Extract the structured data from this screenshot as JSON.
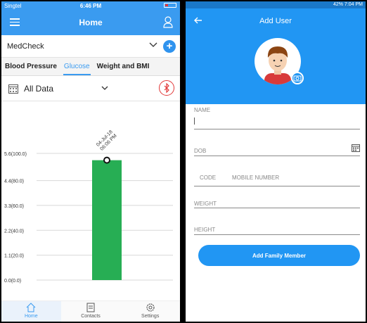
{
  "left": {
    "status": {
      "carrier": "Singtel",
      "time": "6:46 PM"
    },
    "nav": {
      "title": "Home"
    },
    "medcheck": {
      "name": "MedCheck"
    },
    "tabs": [
      "Blood Pressure",
      "Glucose",
      "Weight and BMI"
    ],
    "active_tab": "Glucose",
    "filter": {
      "label": "All Data"
    },
    "bottom_nav": [
      {
        "label": "Home",
        "icon": "home-icon"
      },
      {
        "label": "Contacts",
        "icon": "contacts-icon"
      },
      {
        "label": "Settings",
        "icon": "settings-icon"
      }
    ]
  },
  "right": {
    "status": {
      "text": "42% 7:04 PM"
    },
    "nav": {
      "title": "Add User"
    },
    "fields": {
      "name": "NAME",
      "dob": "DOB",
      "code": "CODE",
      "mobile": "MOBILE NUMBER",
      "weight": "WEIGHT",
      "height": "HEIGHT"
    },
    "submit": "Add Family Member"
  },
  "colors": {
    "accent": "#3a9bf0",
    "right_primary": "#2196f3",
    "bar": "#27ae54",
    "bluetooth": "#e23a3a"
  },
  "chart_data": {
    "type": "bar",
    "categories": [
      "04-Jul-18 06:06 PM"
    ],
    "values": [
      5.3
    ],
    "ytick_labels": [
      "0.0(0.0)",
      "1.1(20.0)",
      "2.2(40.0)",
      "3.3(60.0)",
      "4.4(80.0)",
      "5.6(100.0)"
    ],
    "yticks": [
      0,
      1.1,
      2.2,
      3.3,
      4.4,
      5.6
    ],
    "ylim": [
      0,
      5.6
    ],
    "grid": true
  }
}
